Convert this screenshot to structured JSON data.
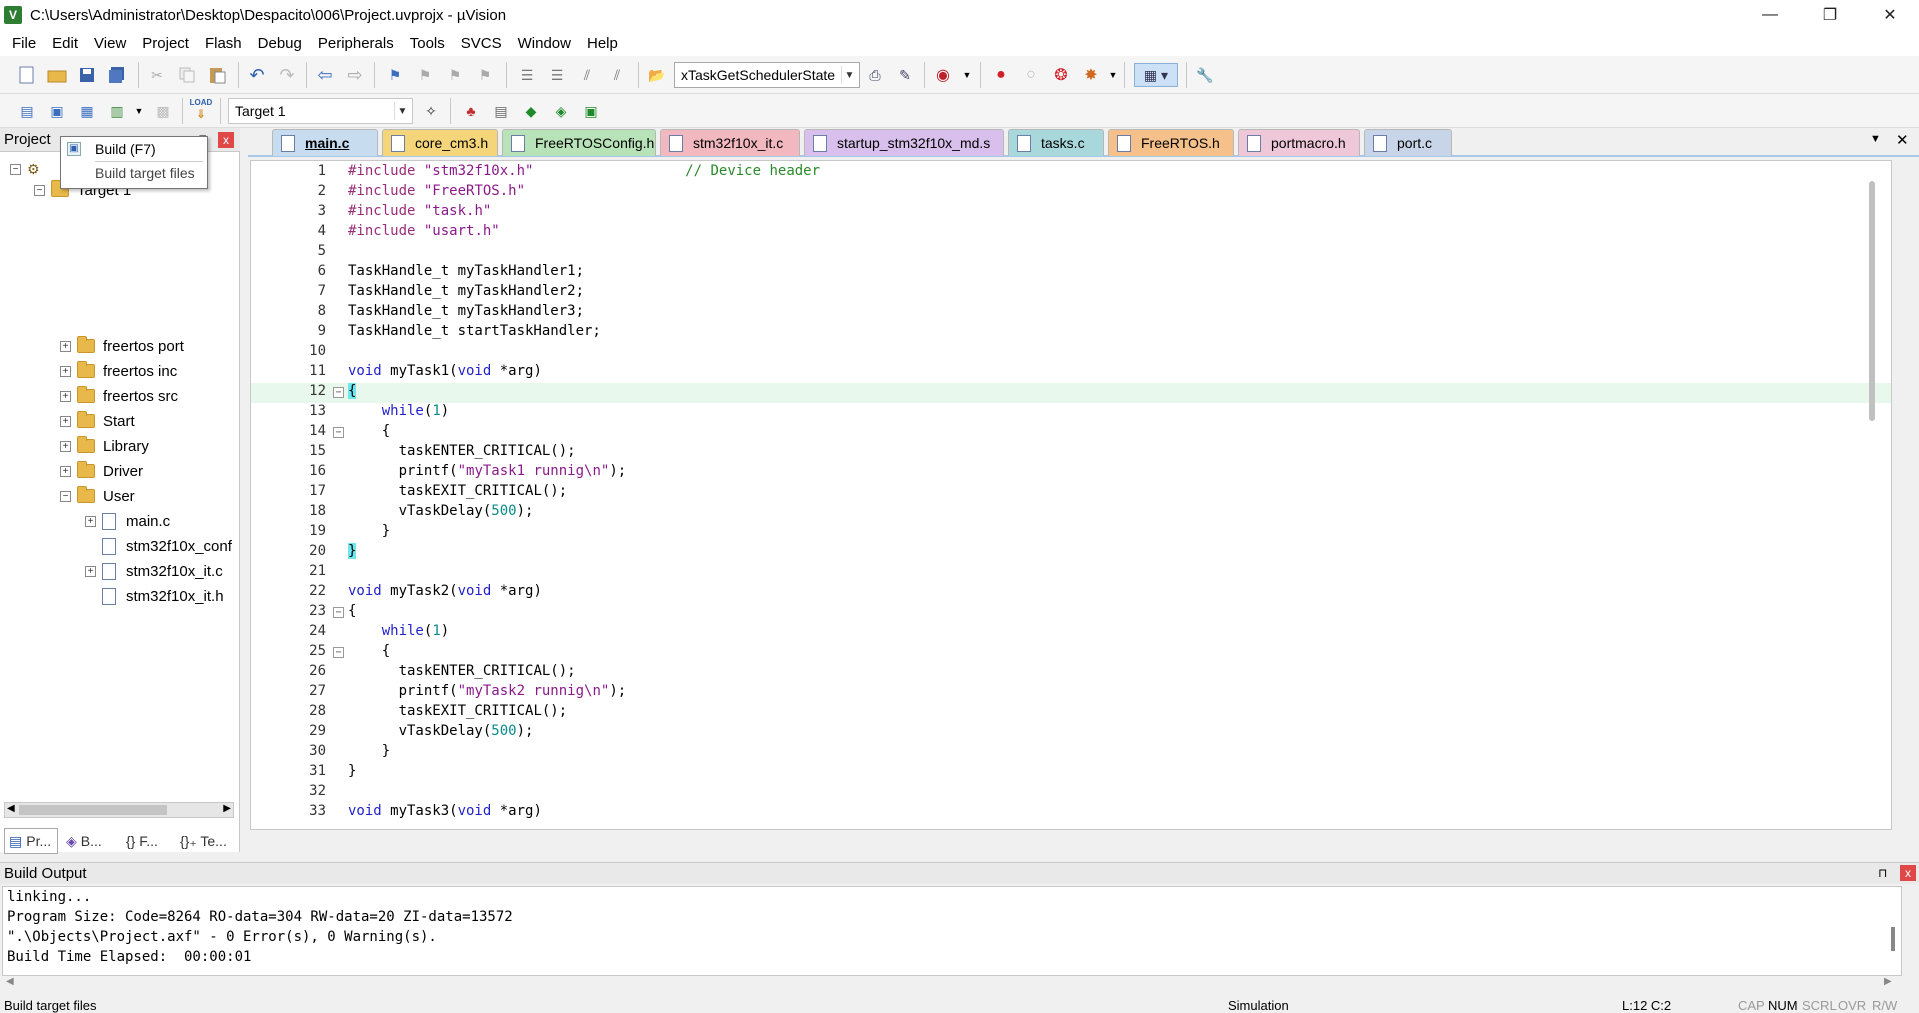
{
  "window": {
    "title": "C:\\Users\\Administrator\\Desktop\\Despacito\\006\\Project.uvprojx - µVision",
    "app_icon": "V",
    "minimize": "—",
    "maximize": "❐",
    "close": "✕"
  },
  "menu": [
    "File",
    "Edit",
    "View",
    "Project",
    "Flash",
    "Debug",
    "Peripherals",
    "Tools",
    "SVCS",
    "Window",
    "Help"
  ],
  "toolbar": {
    "function_combo": "xTaskGetSchedulerState",
    "target_combo": "Target 1",
    "load_label": "LOAD"
  },
  "project_panel": {
    "title": "Project",
    "close": "x",
    "tree": {
      "root": "Target 1",
      "groups": [
        "freertos port",
        "freertos inc",
        "freertos src",
        "Start",
        "Library",
        "Driver",
        "User"
      ],
      "user_files": [
        "main.c",
        "stm32f10x_conf",
        "stm32f10x_it.c",
        "stm32f10x_it.h"
      ]
    },
    "bottom_tabs": [
      "Pr...",
      "B...",
      "{} F...",
      "{}₊ Te..."
    ]
  },
  "tooltip": {
    "title": "Build (F7)",
    "description": "Build target files"
  },
  "editor_tabs": [
    {
      "label": "main.c",
      "color": "#c8dcf0",
      "active": true
    },
    {
      "label": "core_cm3.h",
      "color": "#f5d57a"
    },
    {
      "label": "FreeRTOSConfig.h",
      "color": "#b8e3b8"
    },
    {
      "label": "stm32f10x_it.c",
      "color": "#f2b8c0"
    },
    {
      "label": "startup_stm32f10x_md.s",
      "color": "#d9c0ec"
    },
    {
      "label": "tasks.c",
      "color": "#a8d8dc"
    },
    {
      "label": "FreeRTOS.h",
      "color": "#f6c08a"
    },
    {
      "label": "portmacro.h",
      "color": "#eec8d8"
    },
    {
      "label": "port.c",
      "color": "#c8d4e8"
    }
  ],
  "code_lines": [
    "1",
    "2",
    "3",
    "4",
    "5",
    "6",
    "7",
    "8",
    "9",
    "10",
    "11",
    "12",
    "13",
    "14",
    "15",
    "16",
    "17",
    "18",
    "19",
    "20",
    "21",
    "22",
    "23",
    "24",
    "25",
    "26",
    "27",
    "28",
    "29",
    "30",
    "31",
    "32",
    "33"
  ],
  "code": {
    "l1_inc": "#include",
    "l1_str": "\"stm32f10x.h\"",
    "l1_cmt": "// Device header",
    "l2_inc": "#include",
    "l2_str": "\"FreeRTOS.h\"",
    "l3_inc": "#include",
    "l3_str": "\"task.h\"",
    "l4_inc": "#include",
    "l4_str": "\"usart.h\"",
    "l6": "TaskHandle_t myTaskHandler1;",
    "l7": "TaskHandle_t myTaskHandler2;",
    "l8": "TaskHandle_t myTaskHandler3;",
    "l9": "TaskHandle_t startTaskHandler;",
    "void": "void",
    "while": "while",
    "one": "1",
    "task1": " myTask1(",
    "task2": " myTask2(",
    "task3": " myTask3(",
    "arg": " *arg)",
    "lbrace": "{",
    "rbrace": "}",
    "enter": "taskENTER_CRITICAL();",
    "exit": "taskEXIT_CRITICAL();",
    "printf": "printf(",
    "str1": "\"myTask1 runnig\\n\"",
    "str2": "\"myTask2 runnig\\n\"",
    "close_paren": ");",
    "delay": "vTaskDelay(",
    "delay_val": "500"
  },
  "build_output": {
    "title": "Build Output",
    "lines": [
      "linking...",
      "Program Size: Code=8264 RO-data=304 RW-data=20 ZI-data=13572",
      "\".\\Objects\\Project.axf\" - 0 Error(s), 0 Warning(s).",
      "Build Time Elapsed:  00:00:01"
    ]
  },
  "status": {
    "message": "Build target files",
    "mode": "Simulation",
    "position": "L:12 C:2",
    "cap": "CAP",
    "num": "NUM",
    "scrl": "SCRL",
    "ovr": "OVR",
    "rw": "R/W"
  }
}
